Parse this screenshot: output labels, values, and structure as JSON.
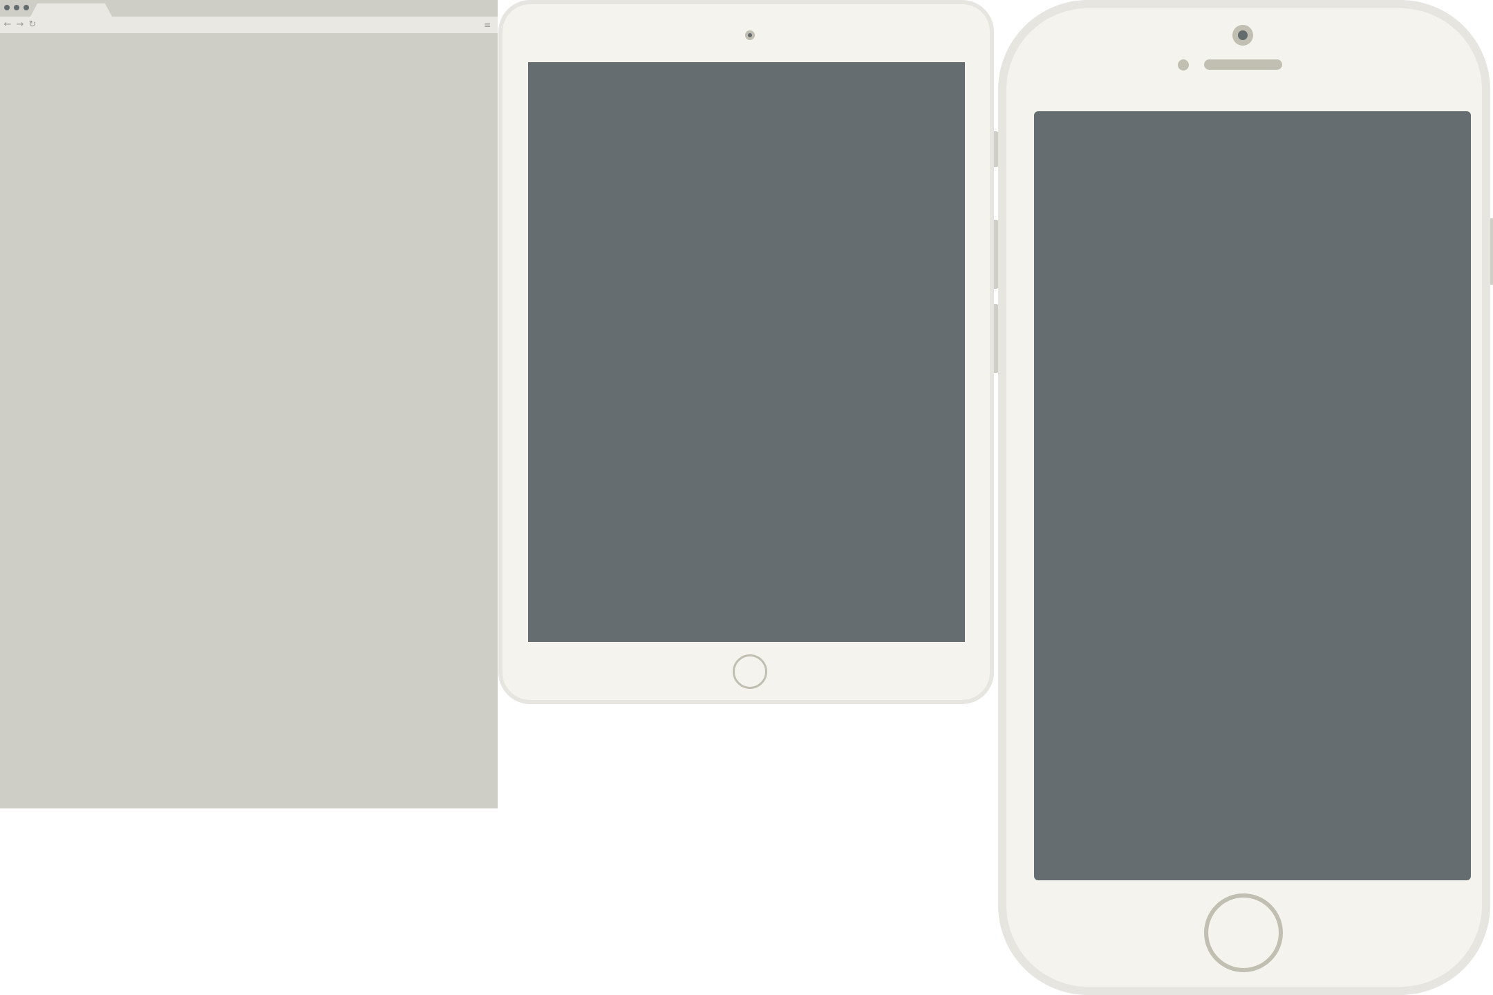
{
  "colors": {
    "frame": "#f4f3ed",
    "bezel": "#e6e5e0",
    "screen": "#656d70",
    "accent": "#c0bfb2",
    "browser_chrome": "#cecec7",
    "browser_toolbar": "#e9e8e3"
  },
  "browser": {
    "window_dots": [
      "window-dot",
      "window-dot",
      "window-dot"
    ],
    "toolbar": {
      "back_glyph": "←",
      "forward_glyph": "→",
      "reload_glyph": "↻",
      "menu_glyph": "≡"
    }
  },
  "tablet": {
    "icons": [
      "camera-icon",
      "home-button"
    ]
  },
  "phone": {
    "icons": [
      "camera-icon",
      "sensor-icon",
      "speaker-grille",
      "home-button"
    ]
  }
}
